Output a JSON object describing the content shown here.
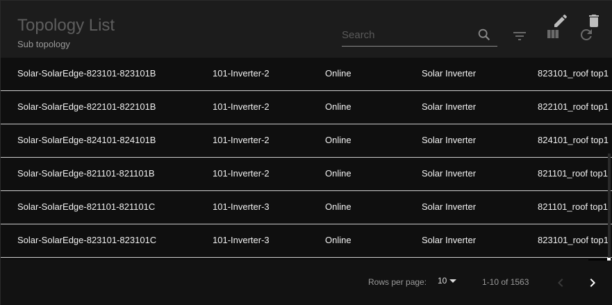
{
  "header": {
    "title": "Topology List",
    "subtitle": "Sub topology",
    "search_placeholder": "Search"
  },
  "toolbar": {
    "icons": [
      "edit-icon",
      "delete-icon",
      "filter-icon",
      "columns-icon",
      "refresh-icon"
    ]
  },
  "rows": [
    {
      "name": "Solar-SolarEdge-823101-823101B",
      "device": "101-Inverter-2",
      "status": "Online",
      "type": "Solar Inverter",
      "location": "823101_roof top1"
    },
    {
      "name": "Solar-SolarEdge-822101-822101B",
      "device": "101-Inverter-2",
      "status": "Online",
      "type": "Solar Inverter",
      "location": "822101_roof top1"
    },
    {
      "name": "Solar-SolarEdge-824101-824101B",
      "device": "101-Inverter-2",
      "status": "Online",
      "type": "Solar Inverter",
      "location": "824101_roof top1"
    },
    {
      "name": "Solar-SolarEdge-821101-821101B",
      "device": "101-Inverter-2",
      "status": "Online",
      "type": "Solar Inverter",
      "location": "821101_roof top1"
    },
    {
      "name": "Solar-SolarEdge-821101-821101C",
      "device": "101-Inverter-3",
      "status": "Online",
      "type": "Solar Inverter",
      "location": "821101_roof top1"
    },
    {
      "name": "Solar-SolarEdge-823101-823101C",
      "device": "101-Inverter-3",
      "status": "Online",
      "type": "Solar Inverter",
      "location": "823101_roof top1"
    }
  ],
  "footer": {
    "rows_per_page_label": "Rows per page:",
    "rows_per_page_value": "10",
    "range_text": "1-10 of 1563"
  },
  "colors": {
    "background": "#121212",
    "header": "#1c1c1c",
    "row_divider": "#cfcfcf",
    "title": "#5e5e5e"
  }
}
